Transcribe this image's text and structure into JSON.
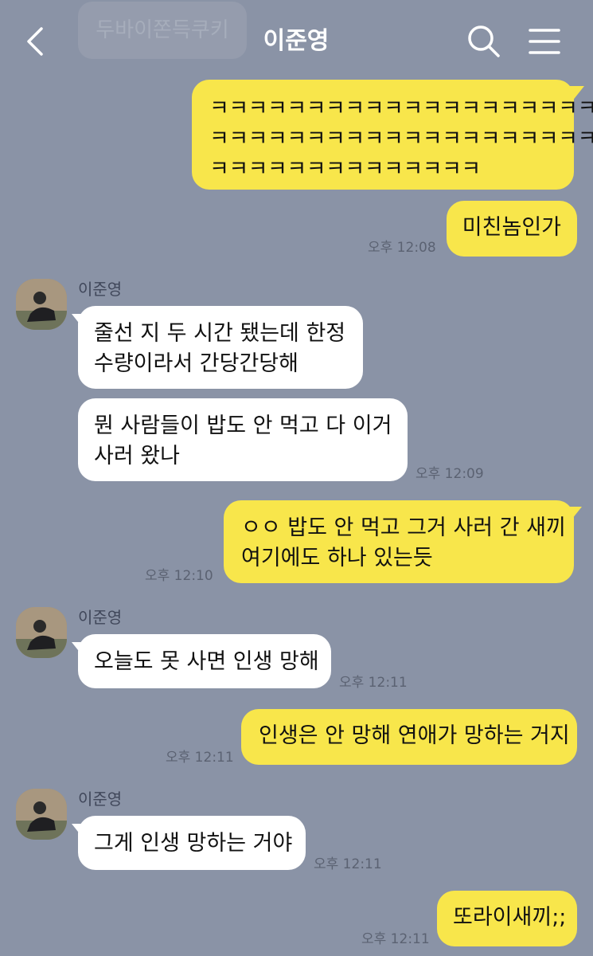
{
  "header": {
    "title": "이준영",
    "prev_chip": "두바이쫀득쿠키",
    "icons": {
      "back": "chevron-left-icon",
      "search": "search-icon",
      "menu": "hamburger-menu-icon"
    }
  },
  "colors": {
    "background": "#8a93a6",
    "my_bubble": "#f8e64b",
    "their_bubble": "#ffffff"
  },
  "messages": [
    {
      "from": "me",
      "text": "ㅋㅋㅋㅋㅋㅋㅋㅋㅋㅋㅋㅋㅋㅋㅋㅋㅋㅋㅋㅋ\nㅋㅋㅋㅋㅋㅋㅋㅋㅋㅋㅋㅋㅋㅋㅋㅋㅋㅋㅋㅋ\nㅋㅋㅋㅋㅋㅋㅋㅋㅋㅋㅋㅋㅋㅋ"
    },
    {
      "from": "me",
      "text": "미친놈인가",
      "time": "오후 12:08"
    },
    {
      "from": "them",
      "sender": "이준영",
      "text": "줄선 지 두 시간 됐는데 한정\n수량이라서 간당간당해"
    },
    {
      "from": "them",
      "text": "뭔 사람들이 밥도 안 먹고 다 이거\n사러 왔나",
      "time": "오후 12:09"
    },
    {
      "from": "me",
      "text": "ㅇㅇ 밥도 안 먹고 그거 사러 간 새끼\n여기에도 하나 있는듯",
      "time": "오후 12:10"
    },
    {
      "from": "them",
      "sender": "이준영",
      "text": "오늘도 못 사면 인생 망해",
      "time": "오후 12:11"
    },
    {
      "from": "me",
      "text": "인생은 안 망해 연애가 망하는 거지",
      "time": "오후 12:11"
    },
    {
      "from": "them",
      "sender": "이준영",
      "text": "그게 인생 망하는 거야",
      "time": "오후 12:11"
    },
    {
      "from": "me",
      "text": "또라이새끼;;",
      "time": "오후 12:11"
    }
  ]
}
